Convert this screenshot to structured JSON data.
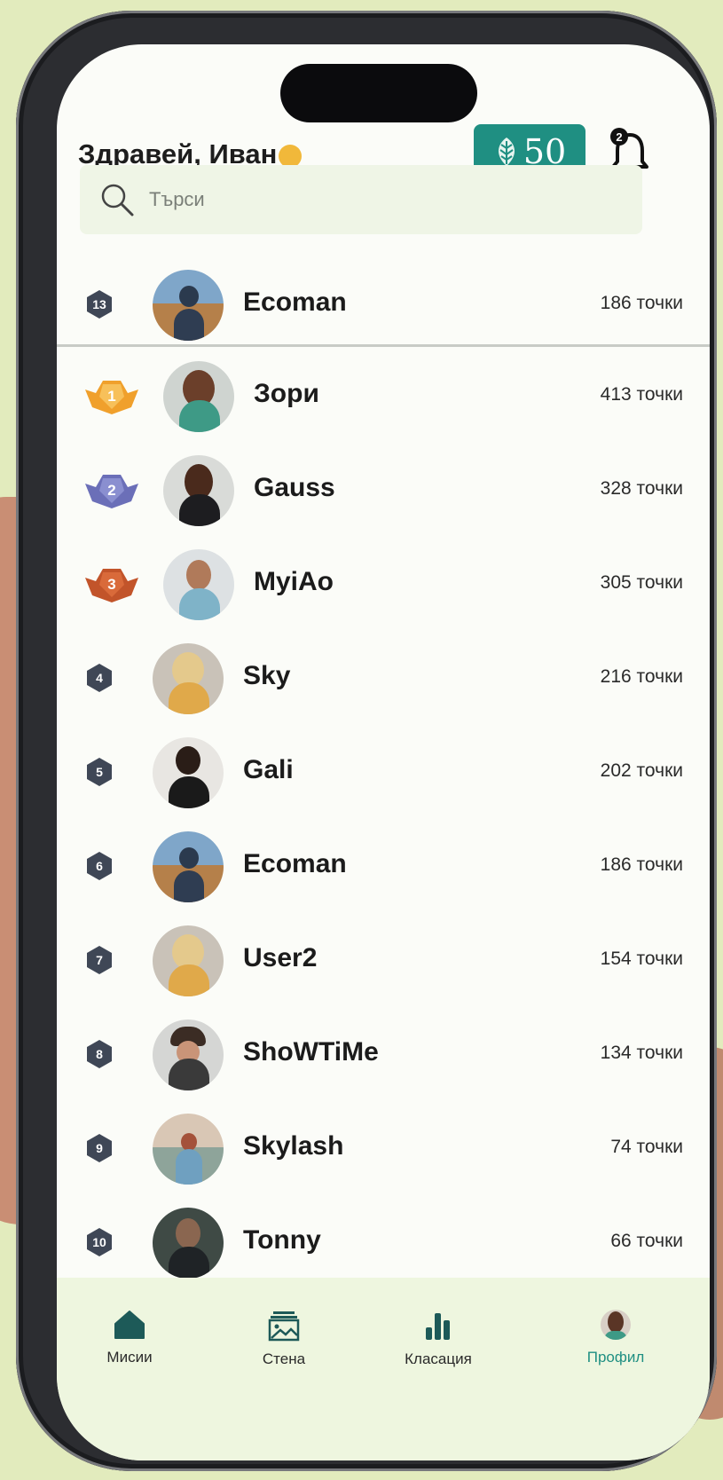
{
  "header": {
    "greeting": "Здравей, Иван",
    "coins": "50",
    "notifications": "2"
  },
  "search": {
    "placeholder": "Търси"
  },
  "current_user": {
    "rank": "13",
    "name": "Ecoman",
    "points": "186 точки"
  },
  "leaderboard": [
    {
      "rank": "1",
      "name": "Зори",
      "points": "413 точки"
    },
    {
      "rank": "2",
      "name": "Gauss",
      "points": "328 точки"
    },
    {
      "rank": "3",
      "name": "MyiAo",
      "points": "305 точки"
    },
    {
      "rank": "4",
      "name": "Sky",
      "points": "216 точки"
    },
    {
      "rank": "5",
      "name": "Gali",
      "points": "202 точки"
    },
    {
      "rank": "6",
      "name": "Ecoman",
      "points": "186 точки"
    },
    {
      "rank": "7",
      "name": "User2",
      "points": "154 точки"
    },
    {
      "rank": "8",
      "name": "ShoWTiMe",
      "points": "134 точки"
    },
    {
      "rank": "9",
      "name": "Skylash",
      "points": "74 точки"
    },
    {
      "rank": "10",
      "name": "Tonny",
      "points": "66 точки"
    }
  ],
  "nav": {
    "items": [
      {
        "label": "Мисии",
        "icon": "home-icon"
      },
      {
        "label": "Стена",
        "icon": "gallery-icon"
      },
      {
        "label": "Класация",
        "icon": "bar-chart-icon"
      },
      {
        "label": "Профил",
        "icon": "avatar-icon"
      }
    ],
    "active": "Профил"
  },
  "colors": {
    "accent": "#1f8f82",
    "gold": "#f0a02c",
    "silver": "#6b6fb8",
    "bronze": "#c2542a",
    "rank_badge": "#3f4756"
  }
}
